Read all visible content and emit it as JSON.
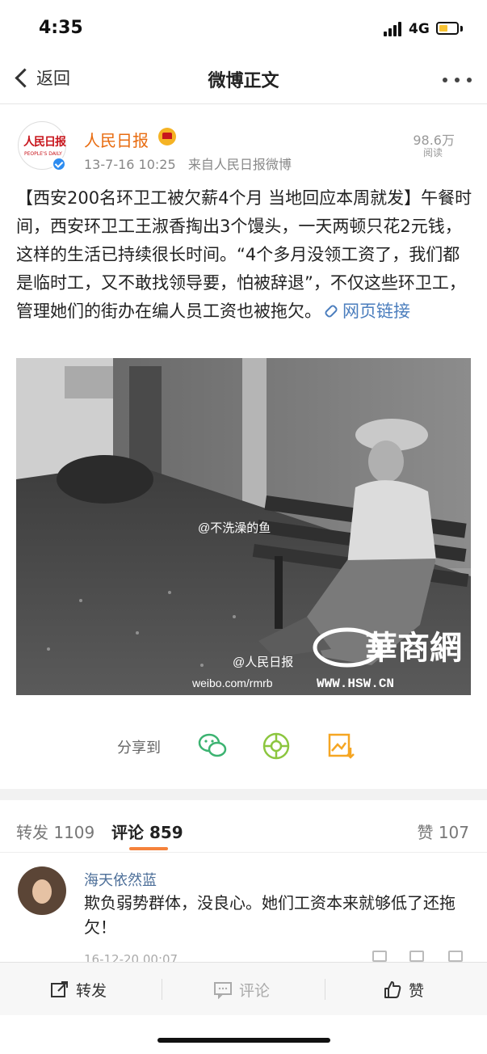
{
  "status": {
    "time": "4:35",
    "network": "4G",
    "battery_color": "#f7c233"
  },
  "nav": {
    "back_label": "返回",
    "title": "微博正文",
    "more_icon": "more-dots-icon"
  },
  "post": {
    "author": "人民日报",
    "avatar_logo_text": "人民日报",
    "avatar_logo_en": "PEOPLE'S DAILY",
    "time": "13-7-16 10:25",
    "source": "来自人民日报微博",
    "read_count": "98.6万",
    "read_label": "阅读",
    "text": "【西安200名环卫工被欠薪4个月 当地回应本周就发】午餐时间，西安环卫工王淑香掏出3个馒头，一天两顿只花2元钱，这样的生活已持续很长时间。“4个多月没领工资了，我们都是临时工，又不敢找领导要，怕被辞退”，不仅这些环卫工，管理她们的街办在编人员工资也被拖欠。",
    "link_label": "网页链接",
    "image": {
      "watermark_user": "@不洗澡的鱼",
      "watermark_account": "@人民日报",
      "watermark_url": "weibo.com/rmrb",
      "logo_cn": "華商網",
      "logo_url": "WWW.HSW.CN"
    }
  },
  "share": {
    "label": "分享到",
    "icons": [
      "wechat-icon",
      "moments-icon",
      "save-image-icon"
    ]
  },
  "tabs": {
    "forward": "转发 1109",
    "comment": "评论 859",
    "like": "赞 107",
    "active_color": "#f5823b"
  },
  "comments": [
    {
      "user": "海天依然蓝",
      "text": "欺负弱势群体，没良心。她们工资本来就够低了还拖欠！",
      "time": "16-12-20 00:07"
    }
  ],
  "bottom_bar": {
    "forward": "转发",
    "comment": "评论",
    "like": "赞"
  },
  "colors": {
    "author": "#e86b0f",
    "link": "#4a7dbd",
    "commenter": "#4d6f99",
    "wechat": "#3cb371",
    "moments": "#8cc63f",
    "image_share": "#f5a623"
  }
}
